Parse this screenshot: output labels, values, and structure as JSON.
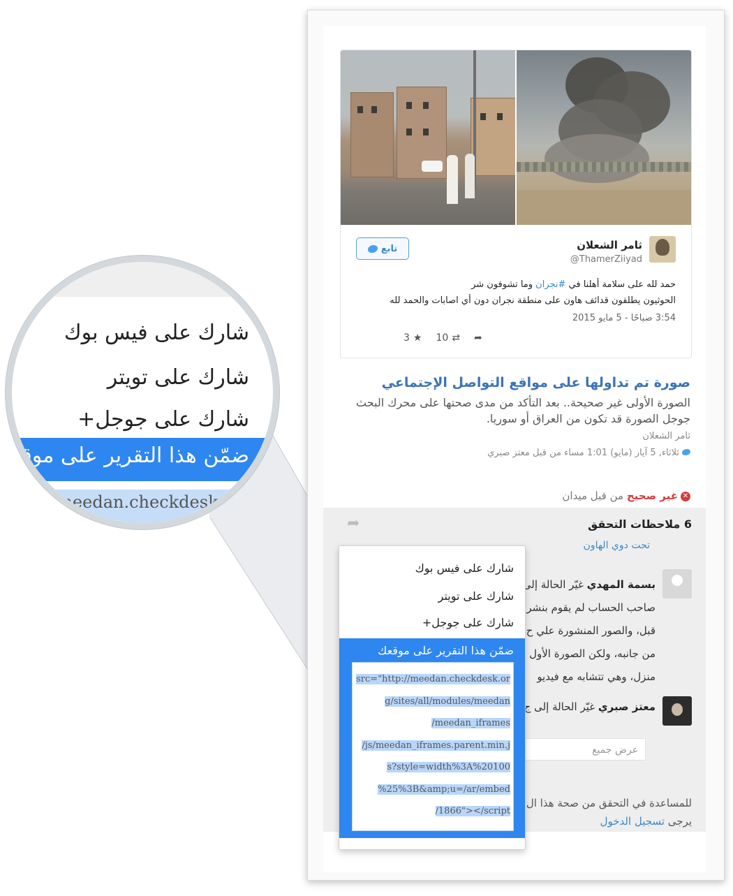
{
  "tweet": {
    "author_name": "ثامر الشعلان",
    "author_handle": "@ThamerZiiyad",
    "follow_label": "تابع",
    "text_before": "حمد لله  على سلامة أهلنا في ",
    "hashtag": "#نجران",
    "text_after": " وما تشوفون شر",
    "text_line2": "الحوثيون يطلقون قدائف هاون على منطقة نجران دون أي اصابات والحمد لله",
    "date": "3:54 صباحًا - 5 مايو 2015",
    "retweets": "10",
    "favorites": "3"
  },
  "report": {
    "title": "صورة تم تداولها على مواقع التواصل الإجتماعي",
    "description": "الصورة الأولى غير صحيحة.. بعد التأكد من مدى صحتها على محرك البحث جوجل الصورة قد تكون من العراق أو سوريا.",
    "author": "ثامر الشعلان",
    "meta": "ثلاثاء, 5 آيار (مايو) 1:01 مساء من قبل معتز صبري",
    "status_label": "غير صحيح",
    "status_by": " من قبل ميدان"
  },
  "notes": {
    "title": "6 ملاحظات التحقق",
    "partial_link": "تحت دوي الهاون",
    "note1_name": "بسمة المهدي",
    "note1_action": " غيّر الحالة إلى",
    "note1_lines": [
      "صاحب الحساب لم يقوم بنشر",
      "قبل، والصور المنشورة علي ح",
      "من جانبه، ولكن الصورة الأول",
      "منزل، وهي تتشابه مع فيديو"
    ],
    "note2_name": "معتز صبري",
    "note2_action": " غيّر الحالة إلى ج",
    "show_all": "عرض جميع",
    "help_text": "للمساعدة في التحقق من صحة هذا ال",
    "login_prefix": "يرجى ",
    "login_link": "تسجيل الدخول"
  },
  "menu": {
    "share_facebook": "شارك على فيس بوك",
    "share_twitter": "شارك على تويتر",
    "share_google": "شارك على جوجل+",
    "embed_label": "ضمّن هذا التقرير على موقعك",
    "embed_code_lines": [
      "src=\"http://meedan.checkdesk.or",
      "g/sites/all/modules/meedan",
      "/meedan_iframes",
      "/js/meedan_iframes.parent.min.j",
      "s?style=width%3A%20100",
      "%25%3B&amp;u=/ar/embed",
      "/1866\"></script"
    ]
  },
  "magnifier": {
    "share_facebook": "شارك على فيس بوك",
    "share_twitter": "شارك على تويتر",
    "share_google": "شارك على جوجل+",
    "embed_label": "ضمّن هذا التقرير على موقعك",
    "code_snippet": "//meedan.checkdesk"
  },
  "colors": {
    "accent": "#2e86f0",
    "link": "#3b73b9",
    "error": "#d43d3d"
  }
}
